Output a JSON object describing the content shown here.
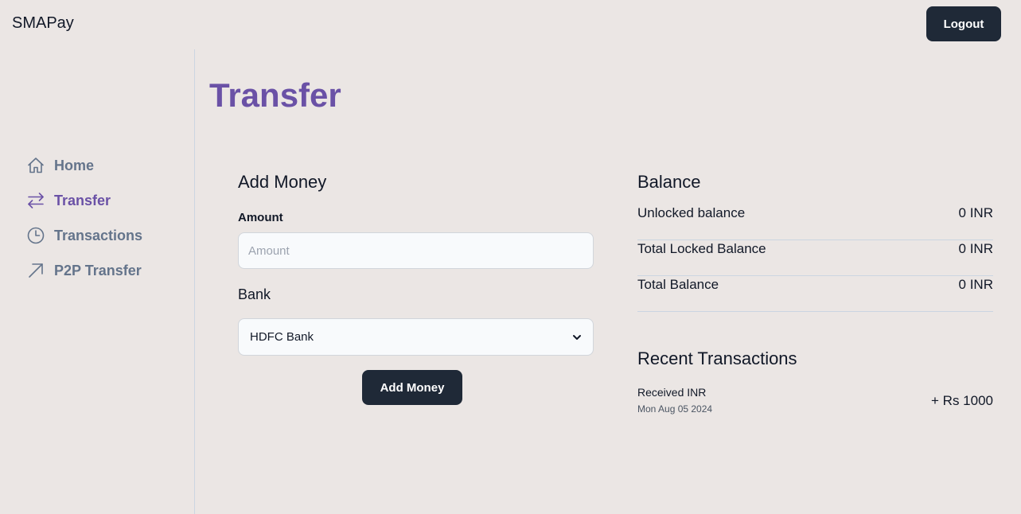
{
  "header": {
    "brand": "SMAPay",
    "logout_label": "Logout"
  },
  "sidebar": {
    "items": [
      {
        "label": "Home",
        "icon": "home-icon",
        "active": false
      },
      {
        "label": "Transfer",
        "icon": "arrows-right-left-icon",
        "active": true
      },
      {
        "label": "Transactions",
        "icon": "clock-icon",
        "active": false
      },
      {
        "label": "P2P Transfer",
        "icon": "arrow-up-right-icon",
        "active": false
      }
    ]
  },
  "page": {
    "title": "Transfer"
  },
  "add_money": {
    "title": "Add Money",
    "amount_label": "Amount",
    "amount_value": "",
    "amount_placeholder": "Amount",
    "bank_label": "Bank",
    "bank_selected": "HDFC Bank",
    "submit_label": "Add Money"
  },
  "balance": {
    "title": "Balance",
    "rows": [
      {
        "label": "Unlocked balance",
        "value": "0 INR"
      },
      {
        "label": "Total Locked Balance",
        "value": "0 INR"
      },
      {
        "label": "Total Balance",
        "value": "0 INR"
      }
    ]
  },
  "recent_transactions": {
    "title": "Recent Transactions",
    "items": [
      {
        "title": "Received INR",
        "date": "Mon Aug 05 2024",
        "amount": "+ Rs 1000"
      }
    ]
  },
  "colors": {
    "background": "#ebe6e4",
    "accent": "#6a51a6",
    "muted_nav": "#64748b",
    "dark_button": "#1f2937"
  }
}
